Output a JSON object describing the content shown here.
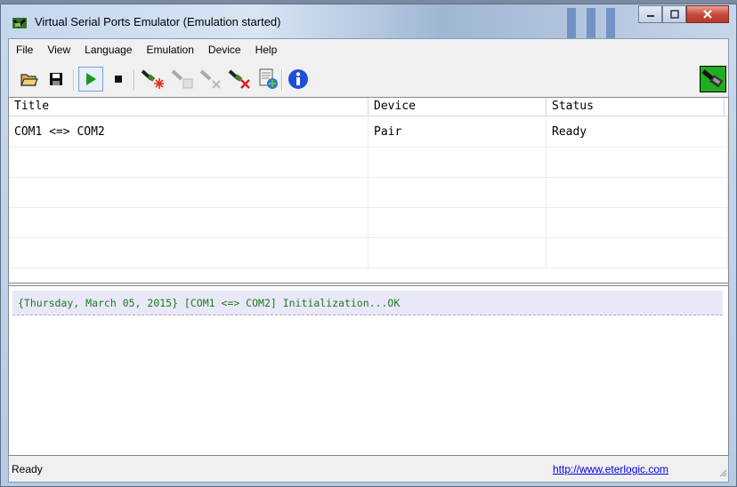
{
  "window": {
    "title": "Virtual Serial Ports Emulator (Emulation started)"
  },
  "menu": [
    "File",
    "View",
    "Language",
    "Emulation",
    "Device",
    "Help"
  ],
  "toolbar": {
    "icons": [
      "open-folder-icon",
      "save-disk-icon",
      "play-icon",
      "stop-icon",
      "new-device-icon",
      "edit-device-icon",
      "delete-device-icon",
      "remove-device-icon",
      "properties-icon",
      "info-icon",
      "logo-icon"
    ]
  },
  "list": {
    "columns": [
      "Title",
      "Device",
      "Status"
    ],
    "rows": [
      {
        "title": "COM1 <=> COM2",
        "device": "Pair",
        "status": "Ready"
      }
    ]
  },
  "log": {
    "entries": [
      "{Thursday, March 05, 2015} [COM1 <=> COM2] Initialization...OK"
    ]
  },
  "statusbar": {
    "text": "Ready",
    "link": "http://www.eterlogic.com"
  },
  "colors": {
    "log_text": "#1e7a1e",
    "play_green": "#1a9a1a",
    "info_blue": "#1e4fd8"
  }
}
